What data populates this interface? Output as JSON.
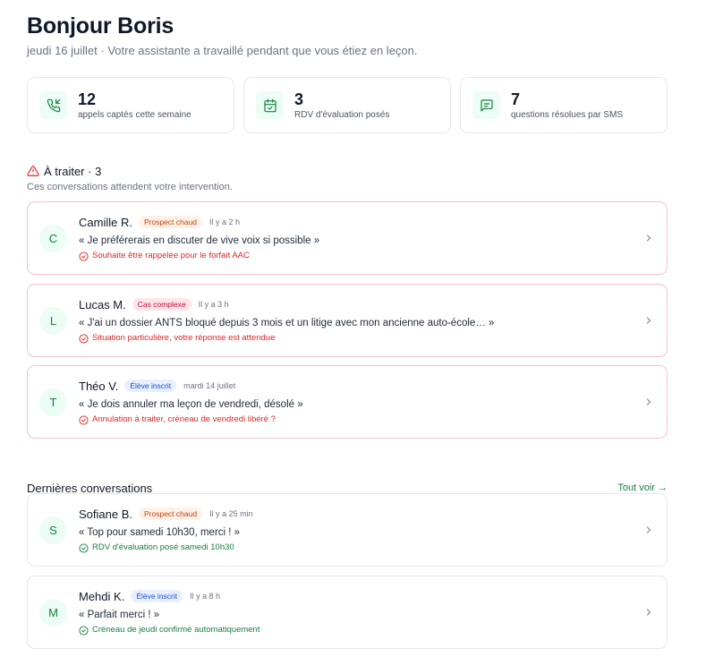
{
  "header": {
    "title": "Bonjour Boris",
    "subtitle": "jeudi 16 juillet · Votre assistante a travaillé pendant que vous étiez en leçon."
  },
  "stats": [
    {
      "value": "12",
      "label": "appels captés cette semaine",
      "icon": "phone-incoming-icon"
    },
    {
      "value": "3",
      "label": "RDV d'évaluation posés",
      "icon": "calendar-check-icon"
    },
    {
      "value": "7",
      "label": "questions résolues par SMS",
      "icon": "message-icon"
    }
  ],
  "todo": {
    "title": "À traiter · 3",
    "description": "Ces conversations attendent votre intervention.",
    "items": [
      {
        "initial": "C",
        "name": "Camille R.",
        "badge": "Prospect chaud",
        "badge_type": "hot",
        "time": "Il y a 2 h",
        "quote": "« Je préférerais en discuter de vive voix si possible »",
        "note": "Souhaite être rappelée pour le forfait AAC"
      },
      {
        "initial": "L",
        "name": "Lucas M.",
        "badge": "Cas complexe",
        "badge_type": "complex",
        "time": "Il y a 3 h",
        "quote": "« J'ai un dossier ANTS bloqué depuis 3 mois et un litige avec mon ancienne auto-école… »",
        "note": "Situation particulière, votre réponse est attendue"
      },
      {
        "initial": "T",
        "name": "Théo V.",
        "badge": "Élève inscrit",
        "badge_type": "enrolled",
        "time": "mardi 14 juillet",
        "quote": "« Je dois annuler ma leçon de vendredi, désolé »",
        "note": "Annulation à traiter, créneau de vendredi libéré ?"
      }
    ]
  },
  "recent": {
    "title": "Dernières conversations",
    "see_all": "Tout voir →",
    "items": [
      {
        "initial": "S",
        "name": "Sofiane B.",
        "badge": "Prospect chaud",
        "badge_type": "hot",
        "time": "Il y a 25 min",
        "quote": "« Top pour samedi 10h30, merci ! »",
        "note": "RDV d'évaluation posé samedi 10h30"
      },
      {
        "initial": "M",
        "name": "Mehdi K.",
        "badge": "Élève inscrit",
        "badge_type": "enrolled",
        "time": "Il y a 8 h",
        "quote": "« Parfait merci ! »",
        "note": "Créneau de jeudi confirmé automatiquement"
      }
    ]
  },
  "colors": {
    "accent": "#15803d",
    "alert": "#dc2626",
    "urgent_border": "#f5c2cb"
  }
}
